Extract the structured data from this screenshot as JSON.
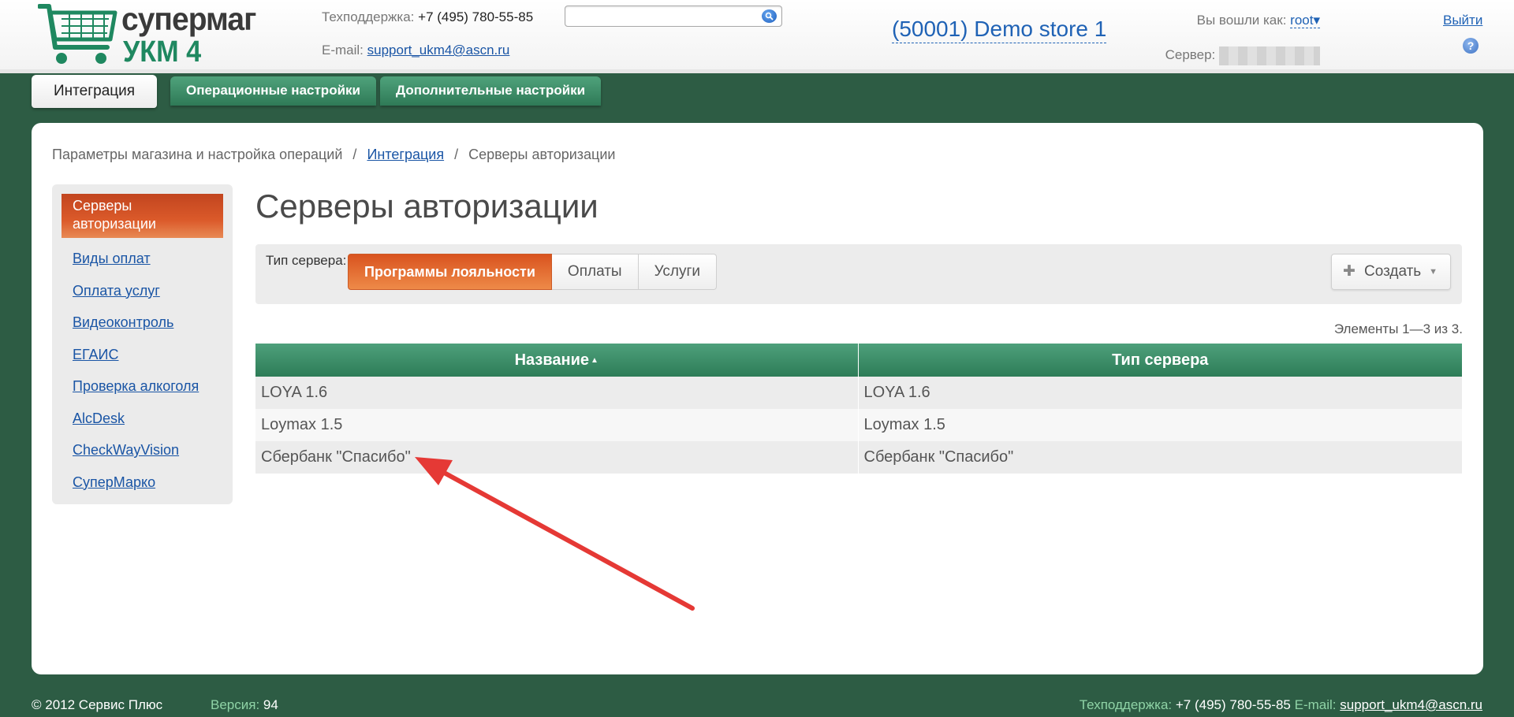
{
  "header": {
    "logo_line1": "супермаг",
    "logo_line2": "УКМ 4",
    "support_label": "Техподдержка:",
    "support_phone": "+7 (495) 780-55-85",
    "email_label": "E-mail:",
    "email_value": "support_ukm4@ascn.ru",
    "search_placeholder": "",
    "store_title": "(50001) Demo store 1",
    "logged_in_label": "Вы вошли как:",
    "user_name": "root",
    "user_caret": "▾",
    "server_label": "Сервер:",
    "logout_label": "Выйти",
    "help_glyph": "?"
  },
  "tabs": [
    {
      "label": "Интеграция",
      "active": true
    },
    {
      "label": "Операционные настройки",
      "active": false
    },
    {
      "label": "Дополнительные настройки",
      "active": false
    }
  ],
  "breadcrumb": {
    "root": "Параметры магазина и настройка операций",
    "separator": "/",
    "middle": "Интеграция",
    "current": "Серверы авторизации"
  },
  "sidenav": [
    {
      "label": "Серверы авторизации",
      "active": true
    },
    {
      "label": "Виды оплат"
    },
    {
      "label": "Оплата услуг"
    },
    {
      "label": "Видеоконтроль"
    },
    {
      "label": "ЕГАИС"
    },
    {
      "label": "Проверка алкоголя"
    },
    {
      "label": "AlcDesk"
    },
    {
      "label": "CheckWayVision"
    },
    {
      "label": "СуперМарко"
    }
  ],
  "page_title": "Серверы авторизации",
  "filter": {
    "label": "Тип сервера:",
    "options": [
      {
        "label": "Программы лояльности",
        "active": true
      },
      {
        "label": "Оплаты"
      },
      {
        "label": "Услуги"
      }
    ],
    "create_label": "Создать",
    "create_plus": "✚",
    "create_caret": "▼"
  },
  "counter": "Элементы 1—3 из 3.",
  "table": {
    "columns": [
      "Название",
      "Тип сервера"
    ],
    "sort_indicator": "▲",
    "rows": [
      [
        "LOYA 1.6",
        "LOYA 1.6"
      ],
      [
        "Loymax 1.5",
        "Loymax 1.5"
      ],
      [
        "Сбербанк \"Спасибо\"",
        "Сбербанк \"Спасибо\""
      ]
    ]
  },
  "footer": {
    "copyright": "© 2012 Сервис Плюс",
    "version_label": "Версия:",
    "version_value": "94",
    "support_label": "Техподдержка:",
    "support_phone": "+7 (495) 780-55-85",
    "email_label": "E-mail:",
    "email_value": "support_ukm4@ascn.ru"
  },
  "colors": {
    "background_green": "#2d5c44",
    "accent_orange": "#db5a2a",
    "link_blue": "#1a55a5",
    "annotation_red": "#e53935"
  }
}
